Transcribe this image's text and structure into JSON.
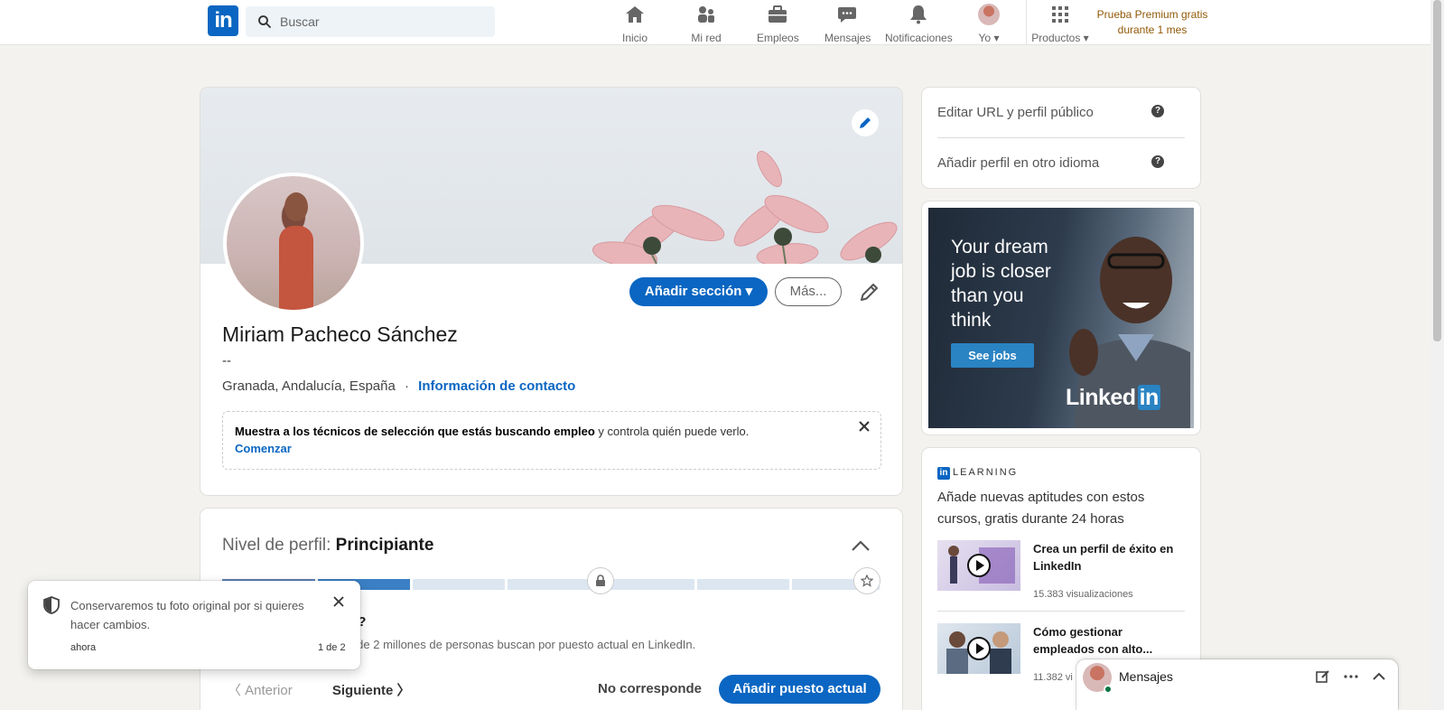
{
  "header": {
    "logo_text": "in",
    "search_placeholder": "Buscar",
    "nav": [
      {
        "label": "Inicio",
        "icon": "home-icon"
      },
      {
        "label": "Mi red",
        "icon": "network-icon"
      },
      {
        "label": "Empleos",
        "icon": "briefcase-icon"
      },
      {
        "label": "Mensajes",
        "icon": "messaging-icon"
      },
      {
        "label": "Notificaciones",
        "icon": "bell-icon"
      },
      {
        "label": "Yo",
        "icon": "me-avatar"
      },
      {
        "label": "Productos",
        "icon": "grid-icon"
      }
    ],
    "premium_line1": "Prueba Premium gratis",
    "premium_line2": "durante 1 mes"
  },
  "profile": {
    "name": "Miriam Pacheco Sánchez",
    "headline": "--",
    "location": "Granada, Andalucía, España",
    "separator": "·",
    "contact_link": "Información de contacto",
    "add_section": "Añadir sección",
    "more": "Más...",
    "notice_bold": "Muestra a los técnicos de selección que estás buscando empleo",
    "notice_rest": " y controla quién puede verlo.",
    "notice_link": "Comenzar"
  },
  "level": {
    "prefix": "Nivel de perfil: ",
    "value": "Principiante",
    "question": "ajas?",
    "sub": "más de 2 millones de personas buscan por puesto actual en LinkedIn.",
    "prev": "Anterior",
    "next": "Siguiente",
    "not_applicable": "No corresponde",
    "add_position": "Añadir puesto actual"
  },
  "sidebar": {
    "edit_url": "Editar URL y perfil público",
    "add_language": "Añadir perfil en otro idioma",
    "help_glyph": "?"
  },
  "ad": {
    "headline": "Your dream job is closer than you think",
    "cta": "See jobs",
    "brand_text": "Linked",
    "brand_in": "in"
  },
  "learning": {
    "label": "LEARNING",
    "in_glyph": "in",
    "description": "Añade nuevas aptitudes con estos cursos, gratis durante 24 horas",
    "courses": [
      {
        "title": "Crea un perfil de éxito en LinkedIn",
        "views": "15.383 visualizaciones"
      },
      {
        "title": "Cómo gestionar empleados con alto...",
        "views": "11.382 vi"
      }
    ]
  },
  "toast": {
    "message": "Conservaremos tu foto original por si quieres hacer cambios.",
    "time": "ahora",
    "count": "1 de 2"
  },
  "messaging": {
    "title": "Mensajes"
  }
}
